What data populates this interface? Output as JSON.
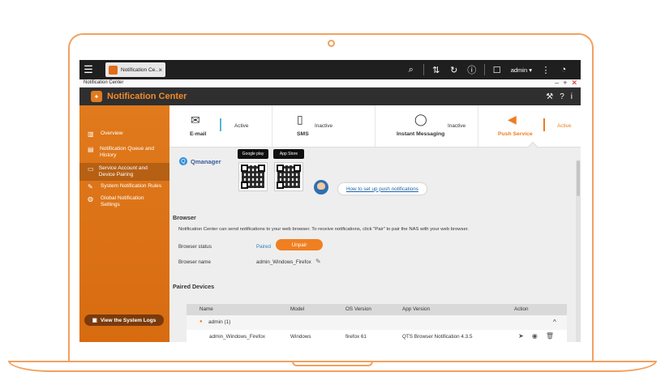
{
  "topbar": {
    "tab_label": "Notification Ce...",
    "tab_close": "×",
    "menu_icon": "☰",
    "search_icon": "⌕",
    "tasks_icon": "⇅",
    "sync_icon": "↻",
    "info_icon": "ⓘ",
    "user_icon": "☐",
    "admin_label": "admin ▾",
    "more_icon": "⋮",
    "dashboard_icon": "◔"
  },
  "window": {
    "title": "Notification Center",
    "minimize": "–",
    "maximize": "+",
    "close": "✕"
  },
  "app": {
    "title": "Notification Center",
    "logo_glyph": "✦",
    "tools_icon": "⚒",
    "help_icon": "?",
    "info_icon": "i"
  },
  "sidebar": {
    "items": [
      {
        "icon": "▥",
        "label": "Overview"
      },
      {
        "icon": "▤",
        "label": "Notification Queue and History"
      },
      {
        "icon": "▭",
        "label": "Service Account and Device Pairing"
      },
      {
        "icon": "✎",
        "label": "System Notification Rules"
      },
      {
        "icon": "◍",
        "label": "Global Notification Settings"
      }
    ],
    "syslog_icon": "▣",
    "syslog_label": "View the System Logs"
  },
  "services": [
    {
      "icon": "✉",
      "label": "E-mail",
      "status": "Active",
      "active": false
    },
    {
      "icon": "▯",
      "label": "SMS",
      "status": "Inactive",
      "active": false
    },
    {
      "icon": "◯",
      "label": "Instant Messaging",
      "status": "Inactive",
      "active": false
    },
    {
      "icon": "◀",
      "label": "Push Service",
      "status": "Active",
      "active": true
    }
  ],
  "qmanager": {
    "logo_glyph": "Q",
    "name": "Qmanager",
    "google_play": "Google play",
    "app_store": "App Store",
    "help_link": "How to set up push notifications"
  },
  "browser": {
    "section_title": "Browser",
    "description": "Notification Center can send notifications to your web browser. To receive notifications, click \"Pair\" to pair the NAS with your web browser.",
    "status_label": "Browser status",
    "status_value": "Paired",
    "unpair_label": "Unpair",
    "name_label": "Browser name",
    "name_value": "admin_Windows_Firefox",
    "edit_icon": "✎"
  },
  "paired_devices": {
    "section_title": "Paired Devices",
    "columns": [
      "Name",
      "Model",
      "OS Version",
      "App Version",
      "Action"
    ],
    "group": {
      "icon": "●",
      "label": "admin (1)",
      "toggle": "^"
    },
    "rows": [
      {
        "name": "admin_Windows_Firefox",
        "model": "Windows",
        "os": "firefox 61",
        "app": "QTS Browser Notification 4.3.5"
      }
    ],
    "action_icons": [
      "➤",
      "◉",
      "🗑"
    ]
  }
}
